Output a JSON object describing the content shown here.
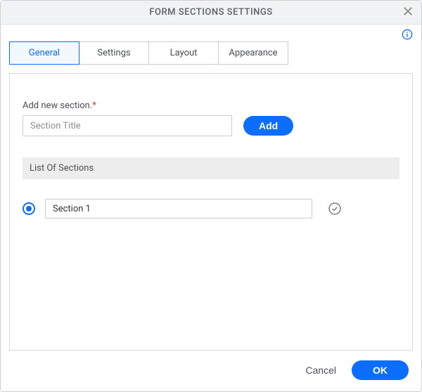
{
  "header": {
    "title": "FORM SECTIONS SETTINGS"
  },
  "tabs": [
    {
      "label": "General",
      "active": true
    },
    {
      "label": "Settings",
      "active": false
    },
    {
      "label": "Layout",
      "active": false
    },
    {
      "label": "Appearance",
      "active": false
    }
  ],
  "form": {
    "add_label": "Add new section.",
    "required_marker": "*",
    "title_placeholder": "Section Title",
    "title_value": "",
    "add_button": "Add",
    "list_header": "List Of Sections",
    "sections": [
      {
        "name": "Section 1",
        "selected": true
      }
    ]
  },
  "footer": {
    "cancel": "Cancel",
    "ok": "OK"
  }
}
